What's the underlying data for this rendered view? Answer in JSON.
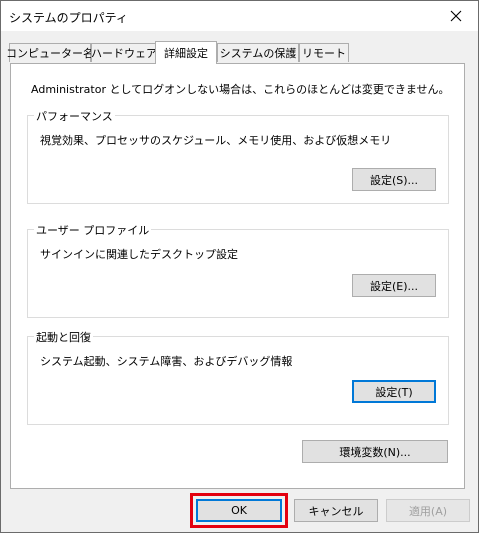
{
  "window": {
    "title": "システムのプロパティ"
  },
  "tabs": [
    {
      "label": "コンピューター名"
    },
    {
      "label": "ハードウェア"
    },
    {
      "label": "詳細設定"
    },
    {
      "label": "システムの保護"
    },
    {
      "label": "リモート"
    }
  ],
  "active_tab": "詳細設定",
  "notice": "Administrator としてログオンしない場合は、これらのほとんどは変更できません。",
  "performance": {
    "title": "パフォーマンス",
    "description": "視覚効果、プロセッサのスケジュール、メモリ使用、および仮想メモリ",
    "button": "設定(S)..."
  },
  "user_profiles": {
    "title": "ユーザー プロファイル",
    "description": "サインインに関連したデスクトップ設定",
    "button": "設定(E)..."
  },
  "startup_recovery": {
    "title": "起動と回復",
    "description": "システム起動、システム障害、およびデバッグ情報",
    "button": "設定(T)"
  },
  "env_button": "環境変数(N)...",
  "footer": {
    "ok": "OK",
    "cancel": "キャンセル",
    "apply": "適用(A)"
  },
  "icons": {
    "close": "close-icon"
  },
  "colors": {
    "highlight": "#e3000f",
    "focus": "#0078d7"
  }
}
